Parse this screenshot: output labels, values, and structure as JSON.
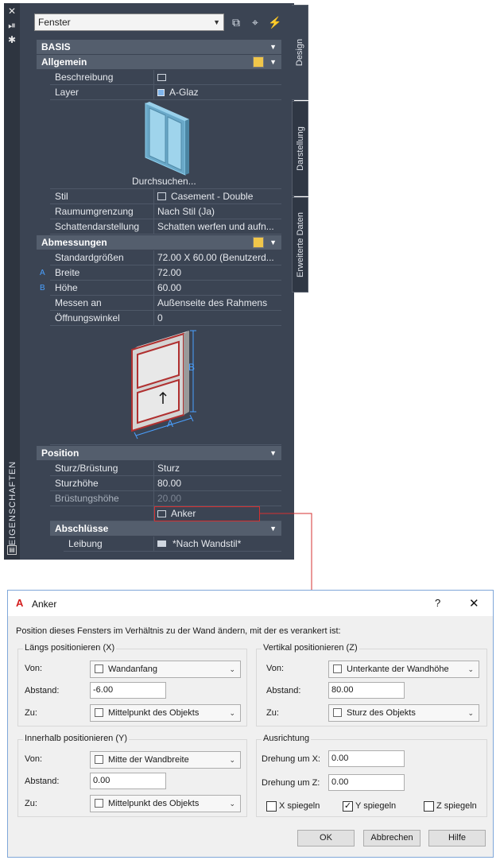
{
  "palette": {
    "dropdown_value": "Fenster",
    "vertical_label": "EIGENSCHAFTEN",
    "tabs": [
      "Design",
      "Darstellung",
      "Erweiterte Daten"
    ],
    "categories": {
      "basis": "BASIS",
      "allgemein": "Allgemein",
      "abmessungen": "Abmessungen",
      "position": "Position",
      "abschluesse": "Abschlüsse"
    },
    "allgemein_rows": [
      {
        "label": "Beschreibung",
        "value": ""
      },
      {
        "label": "Layer",
        "value": "A-Glaz"
      }
    ],
    "browse_label": "Durchsuchen...",
    "allgemein_rows2": [
      {
        "label": "Stil",
        "value": "Casement - Double"
      },
      {
        "label": "Raumumgrenzung",
        "value": "Nach Stil (Ja)"
      },
      {
        "label": "Schattendarstellung",
        "value": "Schatten werfen und aufn..."
      }
    ],
    "abm_rows": [
      {
        "label": "Standardgrößen",
        "value": "72.00  X  60.00 (Benutzerd..."
      },
      {
        "label": "Breite",
        "value": "72.00",
        "marker": "A"
      },
      {
        "label": "Höhe",
        "value": "60.00",
        "marker": "B"
      },
      {
        "label": "Messen an",
        "value": "Außenseite des Rahmens"
      },
      {
        "label": "Öffnungswinkel",
        "value": "0"
      }
    ],
    "diagram_labels": {
      "a": "A",
      "b": "B"
    },
    "pos_rows": [
      {
        "label": "Sturz/Brüstung",
        "value": "Sturz"
      },
      {
        "label": "Sturzhöhe",
        "value": "80.00"
      },
      {
        "label": "Brüstungshöhe",
        "value": "20.00"
      },
      {
        "label": "",
        "value": "Anker"
      }
    ],
    "abs_rows": [
      {
        "label": "Leibung",
        "value": "*Nach Wandstil*"
      }
    ],
    "colors": {
      "accent_red": "#d43030",
      "marker_blue": "#4aa0ff"
    }
  },
  "dialog": {
    "title": "Anker",
    "help": "?",
    "close": "✕",
    "description": "Position dieses Fensters im Verhältnis zu der Wand ändern, mit der es verankert ist:",
    "laengs": {
      "title": "Längs positionieren (X)",
      "von_label": "Von:",
      "von_value": "Wandanfang",
      "abstand_label": "Abstand:",
      "abstand_value": "-6.00",
      "zu_label": "Zu:",
      "zu_value": "Mittelpunkt des Objekts"
    },
    "vertikal": {
      "title": "Vertikal positionieren (Z)",
      "von_label": "Von:",
      "von_value": "Unterkante der Wandhöhe",
      "abstand_label": "Abstand:",
      "abstand_value": "80.00",
      "zu_label": "Zu:",
      "zu_value": "Sturz des Objekts"
    },
    "innerhalb": {
      "title": "Innerhalb positionieren (Y)",
      "von_label": "Von:",
      "von_value": "Mitte der Wandbreite",
      "abstand_label": "Abstand:",
      "abstand_value": "0.00",
      "zu_label": "Zu:",
      "zu_value": "Mittelpunkt des Objekts"
    },
    "ausrichtung": {
      "title": "Ausrichtung",
      "dx_label": "Drehung um X:",
      "dx_value": "0.00",
      "dz_label": "Drehung um Z:",
      "dz_value": "0.00",
      "x_label": "X spiegeln",
      "x_checked": false,
      "y_label": "Y spiegeln",
      "y_checked": true,
      "z_label": "Z spiegeln",
      "z_checked": false
    },
    "buttons": {
      "ok": "OK",
      "cancel": "Abbrechen",
      "help": "Hilfe"
    }
  }
}
